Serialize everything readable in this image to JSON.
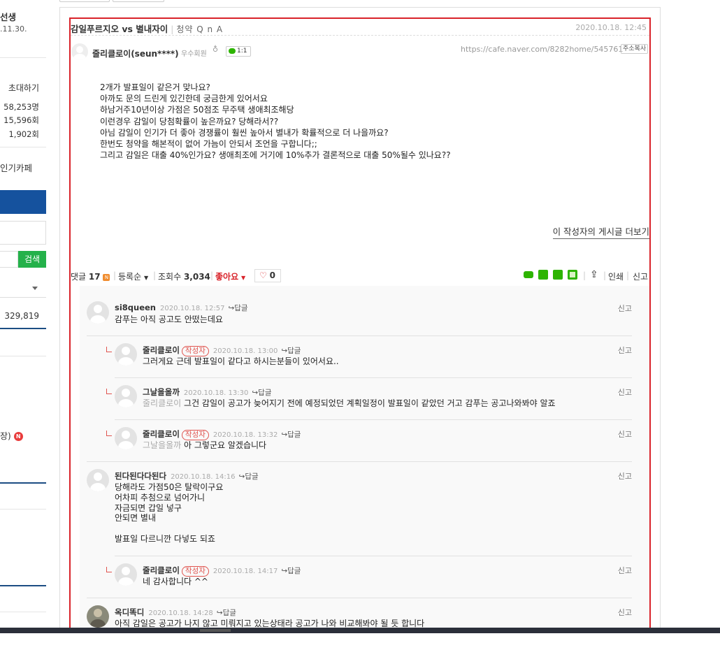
{
  "sidebar": {
    "role_text": "선생",
    "date_text": ".11.30.",
    "invite": "초대하기",
    "members": "58,253명",
    "visits1": "15,596회",
    "visits2": "1,902회",
    "popular": "인기카페",
    "search_button": "검색",
    "counter": "329,819",
    "menu_partial": "장)",
    "new_badge": "N"
  },
  "post": {
    "title": "감일푸르지오 vs 별내자이",
    "board": "청약 Q n A",
    "date": "2020.10.18. 12:45",
    "author": "줄리클로이(seun****)",
    "grade": "우수회원",
    "chat_label": "1:1",
    "url": "https://cafe.naver.com/8282home/545761",
    "copy_url": "주소복사",
    "body": [
      "2개가 발표일이 같은거 맞나요?",
      "아까도 문의 드린게 있긴한데 궁금한게 있어서요",
      "하남거주10년이상 가점은 50점조 무주택 생애최조해당",
      "이런경우 감일이 당첨확률이 높은까요? 당해라서??",
      "아님 감일이 인기가 더 좋아 경쟁률이 훨씬 높아서 별내가 확률적으로 더 나을까요?",
      "한번도 청약을 해본적이 없어 가늠이 안되서 조언을 구합니다;;",
      "그리고 감일은 대출 40%인가요? 생애최조에 거기에 10%추가 결론적으로 대출 50%될수 있나요??"
    ],
    "more_posts": "이 작성자의 게시글 더보기"
  },
  "stats": {
    "comment_label": "댓글",
    "comment_count": "17",
    "new_mark": "N",
    "sort": "등록순",
    "views_label": "조회수",
    "views": "3,034",
    "like_label": "좋아요",
    "like_count": "0",
    "print": "인쇄",
    "report": "신고"
  },
  "comments": [
    {
      "nick": "si8queen",
      "writer": "",
      "date": "2020.10.18. 12:57",
      "reply": "답글",
      "report": "신고",
      "mention": "",
      "lines": [
        "감푸는 아직 공고도 안떴는데요"
      ]
    },
    {
      "nick": "줄리클로이",
      "writer": "작성자",
      "date": "2020.10.18. 13:00",
      "reply": "답글",
      "report": "신고",
      "mention": "",
      "lines": [
        "그러게요 근데 발표일이 같다고 하시는분들이 있어서요.."
      ]
    },
    {
      "nick": "그날을올까",
      "writer": "",
      "date": "2020.10.18. 13:30",
      "reply": "답글",
      "report": "신고",
      "mention": "줄리클로이",
      "lines": [
        "그건 감일이 공고가 늦어지기 전에 예정되었던 계획일정이 발표일이 같았던 거고 감푸는 공고나와봐야 알죠"
      ]
    },
    {
      "nick": "줄리클로이",
      "writer": "작성자",
      "date": "2020.10.18. 13:32",
      "reply": "답글",
      "report": "신고",
      "mention": "그날을올까",
      "lines": [
        "아 그렇군요 알겠습니다"
      ]
    },
    {
      "nick": "된다된다다된다",
      "writer": "",
      "date": "2020.10.18. 14:16",
      "reply": "답글",
      "report": "신고",
      "mention": "",
      "lines": [
        "당해라도 가점50은 탈락이구요",
        "어차피 추첨으로 넘어가니",
        "자금되면 갑일 넣구",
        "안되면 별내",
        "",
        "발표일 다르니깐 다넣도 되죠"
      ]
    },
    {
      "nick": "줄리클로이",
      "writer": "작성자",
      "date": "2020.10.18. 14:17",
      "reply": "답글",
      "report": "신고",
      "mention": "",
      "lines": [
        "네 감사합니다 ^^"
      ]
    },
    {
      "nick": "옥디똑디",
      "writer": "",
      "date": "2020.10.18. 14:28",
      "reply": "답글",
      "report": "신고",
      "mention": "",
      "lines": [
        "아직 감일은 공고가 나지 않고 미뤄지고 있는상태라 공고가 나와 비교해봐야 될 듯 합니다"
      ]
    }
  ]
}
